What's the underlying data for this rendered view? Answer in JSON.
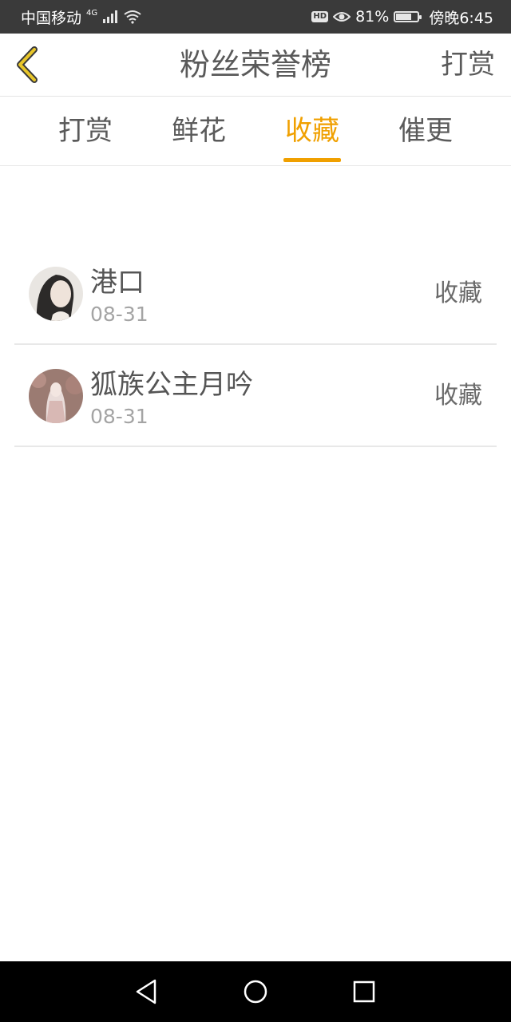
{
  "status_bar": {
    "carrier": "中国移动",
    "network": "4G",
    "battery": "81%",
    "battery_level": 0.81,
    "time": "傍晚6:45",
    "icons": [
      "signal-icon",
      "wifi-icon",
      "hd-icon",
      "eye-icon",
      "battery-icon"
    ]
  },
  "header": {
    "back_icon": "chevron-left-icon",
    "title": "粉丝荣誉榜",
    "right_action": "打赏"
  },
  "tabs": [
    {
      "label": "打赏",
      "active": false
    },
    {
      "label": "鲜花",
      "active": false
    },
    {
      "label": "收藏",
      "active": true
    },
    {
      "label": "催更",
      "active": false
    }
  ],
  "list": [
    {
      "name": "港口",
      "date": "08-31",
      "action": "收藏"
    },
    {
      "name": "狐族公主月吟",
      "date": "08-31",
      "action": "收藏"
    }
  ],
  "nav_bar": {
    "icons": [
      "back-triangle-icon",
      "home-circle-icon",
      "recent-square-icon"
    ]
  },
  "colors": {
    "accent": "#f0a000",
    "status_bar_bg": "#3a3a3a",
    "nav_bar_bg": "#000000",
    "back_icon": "#e8c62a"
  }
}
